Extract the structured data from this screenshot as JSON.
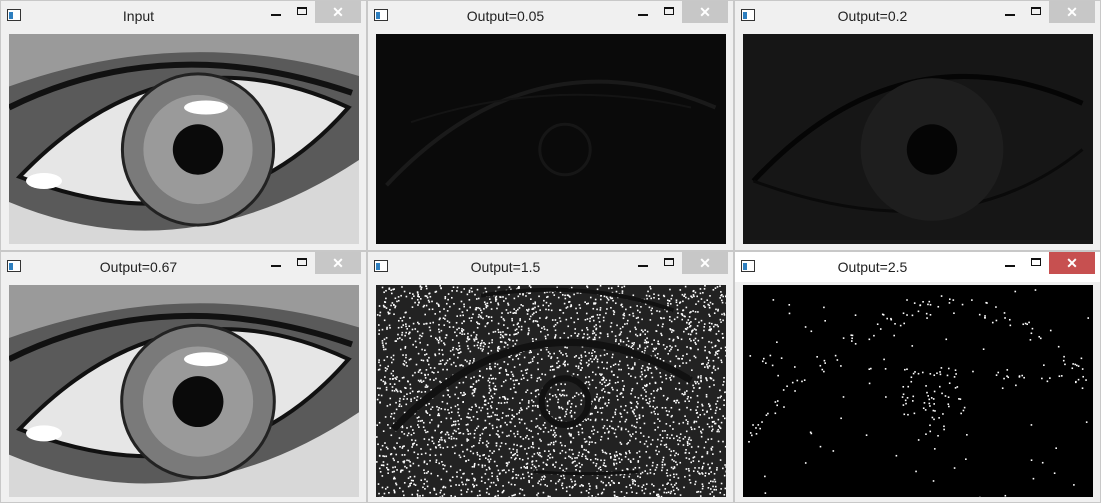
{
  "windows": [
    {
      "title": "Input",
      "close_glyph": "✕",
      "active": false,
      "image_kind": "eye-grayscale"
    },
    {
      "title": "Output=0.05",
      "close_glyph": "✕",
      "active": false,
      "image_kind": "eye-very-dark"
    },
    {
      "title": "Output=0.2",
      "close_glyph": "✕",
      "active": false,
      "image_kind": "eye-dark"
    },
    {
      "title": "Output=0.67",
      "close_glyph": "✕",
      "active": false,
      "image_kind": "eye-grayscale"
    },
    {
      "title": "Output=1.5",
      "close_glyph": "✕",
      "active": false,
      "image_kind": "eye-noise-white"
    },
    {
      "title": "Output=2.5",
      "close_glyph": "✕",
      "active": true,
      "image_kind": "eye-noise-black"
    }
  ],
  "icons": {
    "app": "app-window-icon",
    "minimize": "minimize-icon",
    "maximize": "maximize-icon",
    "close": "close-icon"
  },
  "colors": {
    "close_inactive": "#c7c7c7",
    "close_active": "#c75050",
    "titlebar": "#f0f0f0"
  }
}
